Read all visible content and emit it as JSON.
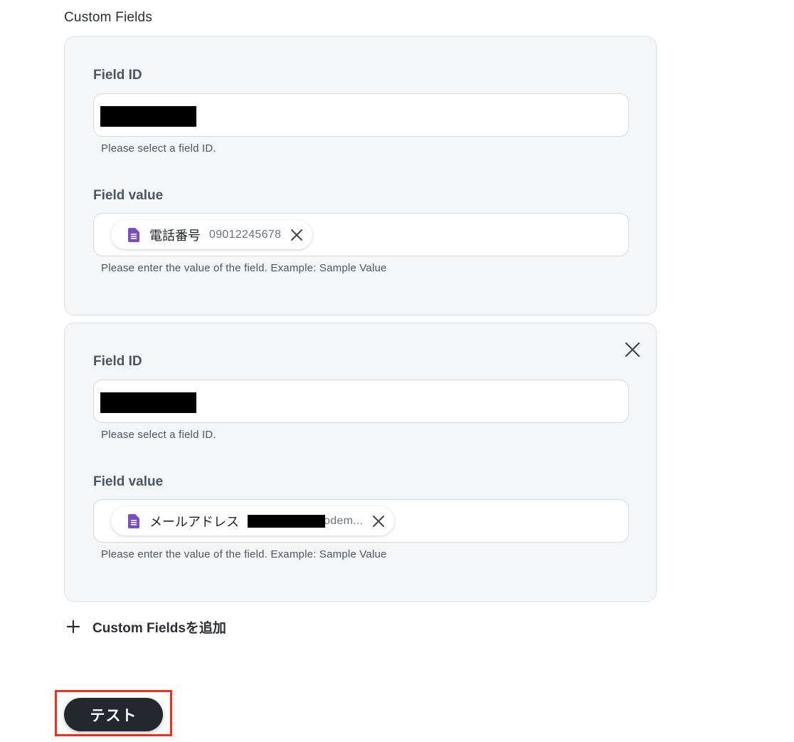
{
  "section": {
    "title": "Custom Fields"
  },
  "fields": [
    {
      "field_id_label": "Field ID",
      "field_id_value": "",
      "field_id_help": "Please select a field ID.",
      "field_value_label": "Field value",
      "chip": {
        "label": "電話番号",
        "value": "09012245678",
        "icon": "google-sheets-icon"
      },
      "field_value_help": "Please enter the value of the field. Example: Sample Value"
    },
    {
      "field_id_label": "Field ID",
      "field_id_value": "",
      "field_id_help": "Please select a field ID.",
      "field_value_label": "Field value",
      "chip": {
        "label": "メールアドレス",
        "value": "odem...",
        "icon": "google-sheets-icon"
      },
      "field_value_help": "Please enter the value of the field. Example: Sample Value"
    }
  ],
  "add_field": {
    "label": "Custom Fieldsを追加",
    "icon": "plus-icon"
  },
  "test_button": {
    "label": "テスト"
  },
  "colors": {
    "card_background": "#f5f6f8",
    "button_background": "#23272e",
    "highlight": "#e8321e",
    "sheets_icon": "#7c4dbe"
  }
}
